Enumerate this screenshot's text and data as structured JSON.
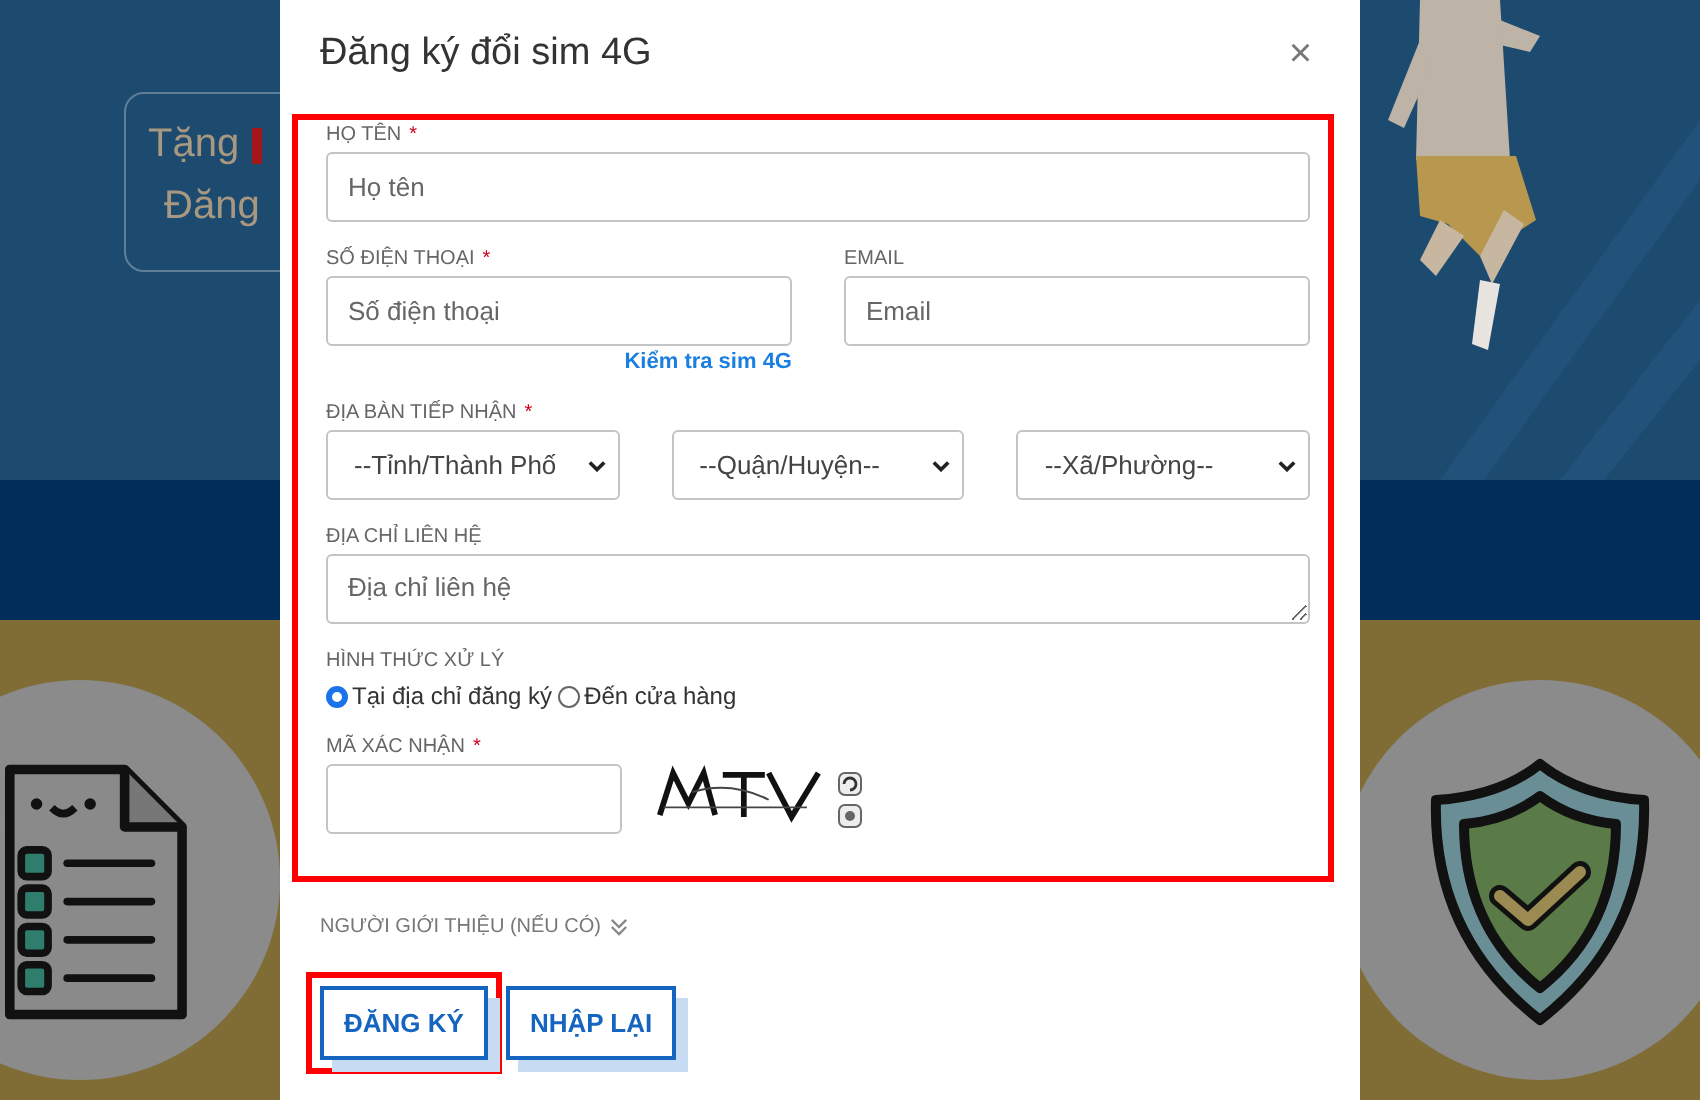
{
  "background": {
    "promo_lines": [
      "Tặng",
      "Đăng"
    ]
  },
  "dialog": {
    "title": "Đăng ký đổi sim 4G",
    "close": "×"
  },
  "form": {
    "highlighted": true,
    "rows": [
      [
        {
          "kind": "text",
          "label": "HỌ TÊN",
          "marker": "*",
          "placeholder": "Họ tên"
        }
      ],
      [
        {
          "kind": "text",
          "label": "SỐ ĐIỆN THOẠI",
          "marker": "*",
          "placeholder": "Số điện thoại",
          "link": "Kiểm tra sim 4G"
        },
        {
          "kind": "text",
          "label": "EMAIL",
          "placeholder": "Email"
        }
      ],
      [
        {
          "kind": "selects",
          "label": "ĐỊA BÀN TIẾP NHẬN",
          "marker": "*",
          "options": [
            "--Tỉnh/Thành Phố",
            "--Quận/Huyện--",
            "--Xã/Phường--"
          ]
        }
      ],
      [
        {
          "kind": "textarea",
          "label": "ĐỊA CHỈ LIÊN HỆ",
          "placeholder": "Địa chỉ liên hệ"
        }
      ],
      [
        {
          "kind": "radio",
          "label": "HÌNH THỨC XỬ LÝ",
          "choices": [
            {
              "label": "Tại địa chỉ đăng ký",
              "selected": true
            },
            {
              "label": "Đến cửa hàng",
              "selected": false
            }
          ]
        }
      ],
      [
        {
          "kind": "captcha",
          "label": "MÃ XÁC NHẬN",
          "marker": "*"
        }
      ]
    ]
  },
  "referrer": {
    "label": "NGƯỜI GIỚI THIỆU (NẾU CÓ)",
    "expanded": false
  },
  "buttons": [
    {
      "label": "ĐĂNG KÝ",
      "highlighted": true
    },
    {
      "label": "NHẬP LẠI",
      "highlighted": false
    }
  ]
}
